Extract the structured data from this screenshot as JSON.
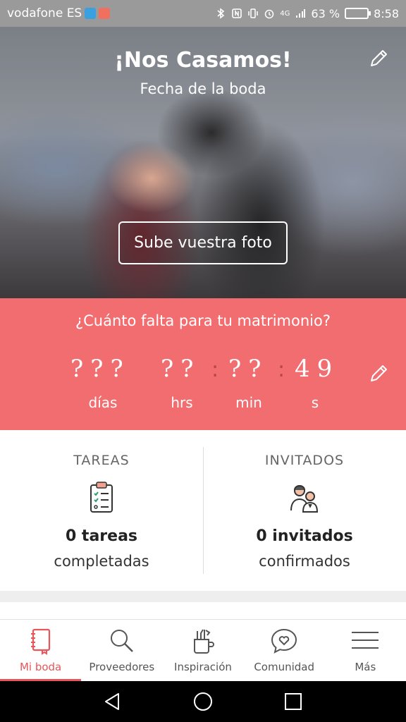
{
  "status_bar": {
    "carrier": "vodafone ES",
    "network": "4G",
    "battery": "63 %",
    "time": "8:58"
  },
  "hero": {
    "title": "¡Nos Casamos!",
    "subtitle": "Fecha de la boda",
    "upload_label": "Sube vuestra foto"
  },
  "countdown": {
    "question": "¿Cuánto falta para tu matrimonio?",
    "days_value": "???",
    "hours_value": "??",
    "minutes_value": "??",
    "seconds_value": "49",
    "days_label": "días",
    "hours_label": "hrs",
    "minutes_label": "min",
    "seconds_label": "s"
  },
  "stats": {
    "tasks": {
      "heading": "TAREAS",
      "count": "0 tareas",
      "desc": "completadas"
    },
    "guests": {
      "heading": "INVITADOS",
      "count": "0 invitados",
      "desc": "confirmados"
    }
  },
  "nav": {
    "items": [
      {
        "label": "Mi boda",
        "icon": "notebook-icon",
        "active": true
      },
      {
        "label": "Proveedores",
        "icon": "search-icon"
      },
      {
        "label": "Inspiración",
        "icon": "tools-cup-icon"
      },
      {
        "label": "Comunidad",
        "icon": "chat-heart-icon"
      },
      {
        "label": "Más",
        "icon": "menu-icon"
      }
    ]
  },
  "colors": {
    "accent": "#f26d70",
    "nav_active": "#e8555a",
    "status_bar": "#9a9a9a"
  }
}
